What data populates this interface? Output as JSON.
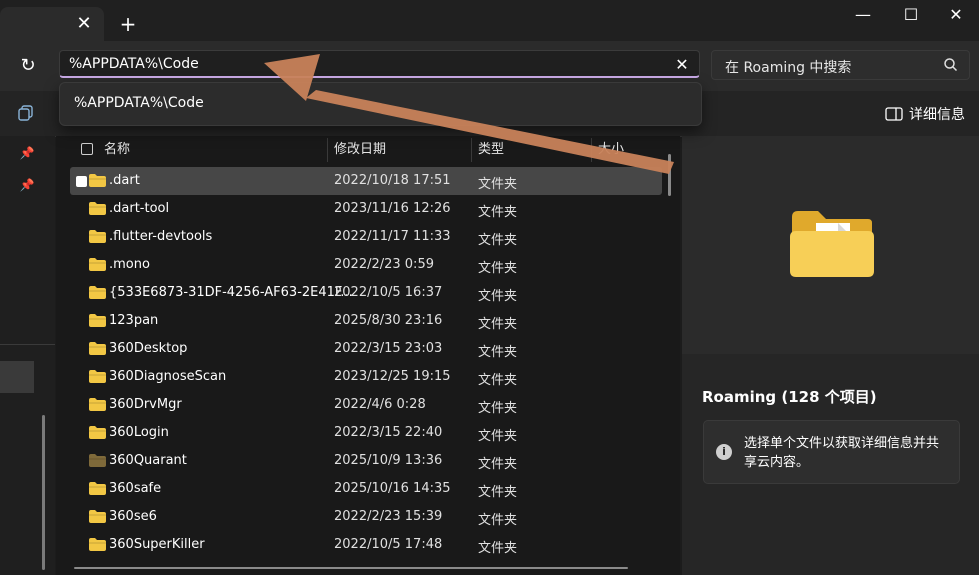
{
  "tab": {
    "close_glyph": "✕"
  },
  "window": {
    "new_tab_glyph": "+",
    "minimize_glyph": "—",
    "maximize_glyph": "☐",
    "close_glyph": "✕"
  },
  "address": {
    "value": "%APPDATA%\\Code",
    "clear_glyph": "✕",
    "refresh_glyph": "↻"
  },
  "search": {
    "placeholder": "在 Roaming 中搜索"
  },
  "suggestion": {
    "item": "%APPDATA%\\Code"
  },
  "toolbar": {
    "details_label": "详细信息"
  },
  "sidebar": {
    "pin_glyph": "📌"
  },
  "columns": {
    "name": "名称",
    "date": "修改日期",
    "type": "类型",
    "size": "大小"
  },
  "files": [
    {
      "name": ".dart",
      "date": "2022/10/18 17:51",
      "type": "文件夹"
    },
    {
      "name": ".dart-tool",
      "date": "2023/11/16 12:26",
      "type": "文件夹"
    },
    {
      "name": ".flutter-devtools",
      "date": "2022/11/17 11:33",
      "type": "文件夹"
    },
    {
      "name": ".mono",
      "date": "2022/2/23 0:59",
      "type": "文件夹"
    },
    {
      "name": "{533E6873-31DF-4256-AF63-2E41F...",
      "date": "2022/10/5 16:37",
      "type": "文件夹"
    },
    {
      "name": "123pan",
      "date": "2025/8/30 23:16",
      "type": "文件夹"
    },
    {
      "name": "360Desktop",
      "date": "2022/3/15 23:03",
      "type": "文件夹"
    },
    {
      "name": "360DiagnoseScan",
      "date": "2023/12/25 19:15",
      "type": "文件夹"
    },
    {
      "name": "360DrvMgr",
      "date": "2022/4/6 0:28",
      "type": "文件夹"
    },
    {
      "name": "360Login",
      "date": "2022/3/15 22:40",
      "type": "文件夹"
    },
    {
      "name": "360Quarant",
      "date": "2025/10/9 13:36",
      "type": "文件夹"
    },
    {
      "name": "360safe",
      "date": "2025/10/16 14:35",
      "type": "文件夹"
    },
    {
      "name": "360se6",
      "date": "2022/2/23 15:39",
      "type": "文件夹"
    },
    {
      "name": "360SuperKiller",
      "date": "2022/10/5 17:48",
      "type": "文件夹"
    }
  ],
  "details": {
    "title": "Roaming (128 个项目)",
    "info": "选择单个文件以获取详细信息并共享云内容。",
    "info_glyph": "i"
  },
  "colors": {
    "folder": "#f2c744",
    "folder_dim": "#7f6a3a",
    "annotation_arrow": "#c8825a",
    "address_underline": "#c8a9e6"
  }
}
